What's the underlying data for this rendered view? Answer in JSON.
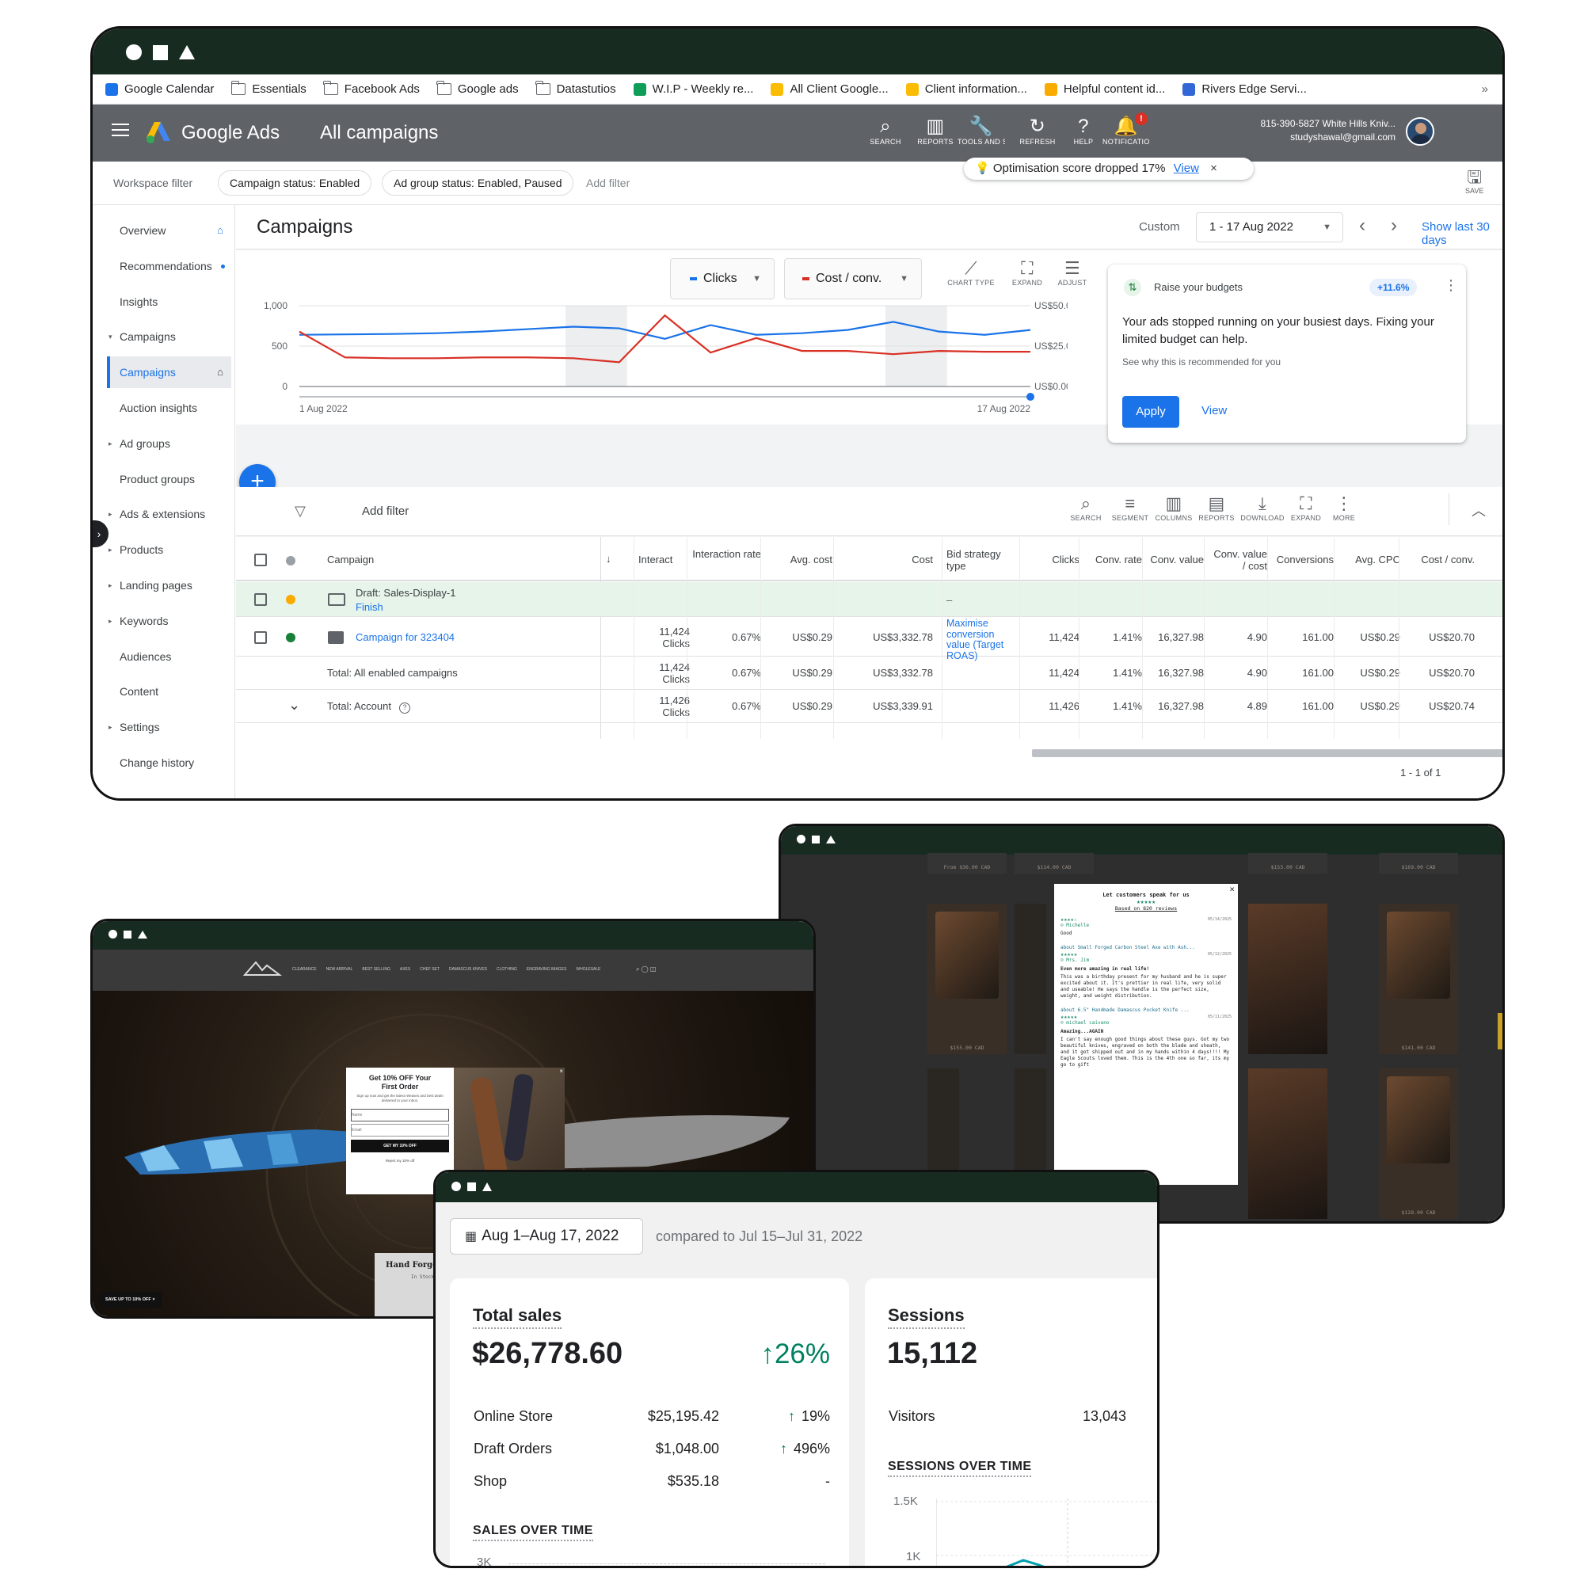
{
  "bookmarks": [
    {
      "label": "Google Calendar",
      "icon": "calendar-icon"
    },
    {
      "label": "Essentials",
      "icon": "folder-icon"
    },
    {
      "label": "Facebook Ads",
      "icon": "folder-icon"
    },
    {
      "label": "Google ads",
      "icon": "folder-icon"
    },
    {
      "label": "Datastutios",
      "icon": "folder-icon"
    },
    {
      "label": "W.I.P - Weekly re...",
      "icon": "sheets-icon"
    },
    {
      "label": "All Client Google...",
      "icon": "drive-icon"
    },
    {
      "label": "Client information...",
      "icon": "drive-icon"
    },
    {
      "label": "Helpful content id...",
      "icon": "keep-icon"
    },
    {
      "label": "Rivers Edge Servi...",
      "icon": "site-icon"
    }
  ],
  "bookmarks_more": "»",
  "header": {
    "brand": "Google Ads",
    "title": "All campaigns",
    "tools": [
      {
        "label": "SEARCH",
        "glyph": "⌕",
        "icon": "search-icon"
      },
      {
        "label": "REPORTS",
        "glyph": "▥",
        "icon": "reports-icon"
      },
      {
        "label": "TOOLS AND SETTINGS",
        "glyph": "🔧",
        "icon": "tools-icon"
      },
      {
        "label": "REFRESH",
        "glyph": "↻",
        "icon": "refresh-icon"
      },
      {
        "label": "HELP",
        "glyph": "?",
        "icon": "help-icon"
      },
      {
        "label": "NOTIFICATIONS",
        "glyph": "🔔",
        "icon": "bell-icon"
      }
    ],
    "notification_badge": "!",
    "account_line1": "815-390-5827 White Hills Kniv...",
    "account_line2": "studyshawal@gmail.com"
  },
  "optimisation_toast": {
    "text": "Optimisation score dropped 17%",
    "link": "View",
    "close": "×"
  },
  "filters": {
    "label": "Workspace filter",
    "chips": [
      "Campaign status: Enabled",
      "Ad group status: Enabled, Paused"
    ],
    "add": "Add filter",
    "save": "SAVE"
  },
  "sidebar": {
    "items": [
      {
        "label": "Overview",
        "caret": ""
      },
      {
        "label": "Recommendations",
        "caret": ""
      },
      {
        "label": "Insights",
        "caret": ""
      },
      {
        "label": "Campaigns",
        "caret": "▾"
      },
      {
        "label": "Campaigns",
        "caret": ""
      },
      {
        "label": "Auction insights",
        "caret": ""
      },
      {
        "label": "Ad groups",
        "caret": "▸"
      },
      {
        "label": "Product groups",
        "caret": ""
      },
      {
        "label": "Ads & extensions",
        "caret": "▸"
      },
      {
        "label": "Products",
        "caret": "▸"
      },
      {
        "label": "Landing pages",
        "caret": "▸"
      },
      {
        "label": "Keywords",
        "caret": "▸"
      },
      {
        "label": "Audiences",
        "caret": ""
      },
      {
        "label": "Content",
        "caret": ""
      },
      {
        "label": "Settings",
        "caret": "▸"
      },
      {
        "label": "Change history",
        "caret": ""
      }
    ]
  },
  "campaigns": {
    "title": "Campaigns",
    "custom_label": "Custom",
    "date_range": "1 - 17 Aug 2022",
    "show_last": "Show last 30 days"
  },
  "chart_controls": {
    "metric1": "Clicks",
    "metric2": "Cost / conv.",
    "tools": [
      {
        "label": "CHART TYPE",
        "glyph": "⟋",
        "icon": "chart-type-icon"
      },
      {
        "label": "EXPAND",
        "glyph": "⛶",
        "icon": "expand-icon"
      },
      {
        "label": "ADJUST",
        "glyph": "☰",
        "icon": "adjust-icon"
      }
    ]
  },
  "chart_data": {
    "type": "line",
    "x": [
      "1 Aug 2022",
      "2",
      "3",
      "4",
      "5",
      "6",
      "7",
      "8",
      "9",
      "10",
      "11",
      "12",
      "13",
      "14",
      "15",
      "16",
      "17 Aug 2022"
    ],
    "x_tick_labels": [
      "1 Aug 2022",
      "17 Aug 2022"
    ],
    "series": [
      {
        "name": "Clicks",
        "axis": "left",
        "color": "#1a73e8",
        "values": [
          640,
          645,
          650,
          660,
          680,
          710,
          740,
          720,
          590,
          760,
          640,
          660,
          700,
          800,
          680,
          640,
          700
        ]
      },
      {
        "name": "Cost / conv.",
        "axis": "right",
        "color": "#d93025",
        "values": [
          34,
          18,
          17.5,
          17.5,
          18,
          18,
          17.5,
          15,
          44,
          21,
          30,
          22,
          22,
          20,
          22,
          21.5,
          21.5
        ]
      }
    ],
    "ylim_left": [
      0,
      1000
    ],
    "yticks_left": [
      "1,000",
      "500",
      "0"
    ],
    "ylim_right": [
      0,
      50
    ],
    "yticks_right": [
      "US$50.00",
      "US$25.00",
      "US$0.00"
    ],
    "weekend_shading": [
      [
        6,
        7
      ],
      [
        13,
        14
      ]
    ],
    "grid": true
  },
  "recommendation": {
    "title": "Raise your budgets",
    "badge": "+11.6%",
    "body": "Your ads stopped running on your busiest days. Fixing your limited budget can help.",
    "sub": "See why this is recommended for you",
    "apply": "Apply",
    "view": "View"
  },
  "table_toolbar": {
    "add_filter": "Add filter",
    "tools": [
      {
        "label": "SEARCH",
        "glyph": "⌕",
        "icon": "search-icon"
      },
      {
        "label": "SEGMENT",
        "glyph": "≡",
        "icon": "segment-icon"
      },
      {
        "label": "COLUMNS",
        "glyph": "▥",
        "icon": "columns-icon"
      },
      {
        "label": "REPORTS",
        "glyph": "▤",
        "icon": "reports-icon"
      },
      {
        "label": "DOWNLOAD",
        "glyph": "⤓",
        "icon": "download-icon"
      },
      {
        "label": "EXPAND",
        "glyph": "⛶",
        "icon": "expand-icon"
      },
      {
        "label": "MORE",
        "glyph": "⋮",
        "icon": "more-icon"
      }
    ]
  },
  "table": {
    "headers": [
      "Campaign",
      "Interact",
      "Interaction rate",
      "Avg. cost",
      "Cost",
      "Bid strategy type",
      "Clicks",
      "Conv. rate",
      "Conv. value",
      "Conv. value / cost",
      "Conversions",
      "Avg. CPC",
      "Cost / conv."
    ],
    "draft": {
      "name": "Draft: Sales-Display-1",
      "action": "Finish",
      "bid": "–"
    },
    "rows": [
      {
        "name": "Campaign for 323404",
        "interact": "11,424",
        "interact_unit": "Clicks",
        "rate": "0.67%",
        "avg_cost": "US$0.29",
        "cost": "US$3,332.78",
        "bid": "Maximise conversion value (Target ROAS)",
        "clicks": "11,424",
        "conv_rate": "1.41%",
        "conv_value": "16,327.98",
        "cv_cost": "4.90",
        "conversions": "161.00",
        "avg_cpc": "US$0.29",
        "cost_conv": "US$20.70"
      },
      {
        "name": "Total: All enabled campaigns",
        "interact": "11,424",
        "interact_unit": "Clicks",
        "rate": "0.67%",
        "avg_cost": "US$0.29",
        "cost": "US$3,332.78",
        "bid": "",
        "clicks": "11,424",
        "conv_rate": "1.41%",
        "conv_value": "16,327.98",
        "cv_cost": "4.90",
        "conversions": "161.00",
        "avg_cpc": "US$0.29",
        "cost_conv": "US$20.70"
      },
      {
        "name": "Total: Account",
        "interact": "11,426",
        "interact_unit": "Clicks",
        "rate": "0.67%",
        "avg_cost": "US$0.29",
        "cost": "US$3,339.91",
        "bid": "",
        "clicks": "11,426",
        "conv_rate": "1.41%",
        "conv_value": "16,327.98",
        "cv_cost": "4.89",
        "conversions": "161.00",
        "avg_cpc": "US$0.29",
        "cost_conv": "US$20.74"
      }
    ],
    "pagination": "1 - 1 of 1"
  },
  "store": {
    "nav": [
      "CLEARANCE",
      "NEW ARRIVAL",
      "BEST SELLING",
      "AXES",
      "CHEF SET",
      "DAMASCUS KNIVES",
      "CLOTHING",
      "ENGRAVING IMAGES",
      "WHOLESALE"
    ],
    "popup_title": "Get 10% OFF Your First Order",
    "popup_sub": "Sign up now and get the latest releases and best deals delivered to your inbox.",
    "name_placeholder": "Name",
    "email_placeholder": "Email",
    "cta": "GET MY 10% OFF",
    "reject": "Reject my 10% off",
    "hero_caption": "Hand Forge",
    "hero_stock": "In Stock",
    "bottom_badge": "SAVE UP TO 10% OFF"
  },
  "reviews": {
    "title": "Let customers speak for us",
    "stars": "★★★★★",
    "based_on": "Based on 820 reviews",
    "items": [
      {
        "stars": "★★★★☆",
        "name": "Michelle",
        "date": "05/14/2025",
        "text": "Good"
      },
      {
        "about": "about Small Forged Carbon Steel Axe with Ash...",
        "stars": "★★★★★",
        "name": "Mrs. Jim",
        "date": "05/12/2025",
        "headline": "Even more amazing in real life!",
        "text": "This was a birthday present for my husband and he is super excited about it. It's prettier in real life, very solid and useable! He says the handle is the perfect size, weight, and weight distribution."
      },
      {
        "about": "about 6.5\" Handmade Damascus Pocket Knife ...",
        "stars": "★★★★★",
        "name": "michael caivano",
        "date": "05/11/2025",
        "headline": "Amazing...AGAIN",
        "text": "I can't say enough good things about these guys. Got my two beautiful knives, engraved on both the blade and sheath, and it got shipped out and in my hands within 4 days!!!! My Eagle Scouts loved them. This is the 4th one so far, its my go to gift"
      }
    ],
    "prices": [
      "From $36.00 CAD",
      "$114.00 CAD",
      "$153.00 CAD",
      "$169.00 CAD",
      "$155.00 CAD",
      "$141.00 CAD",
      "$128.00 CAD"
    ]
  },
  "shopify": {
    "date_range": "Aug 1–Aug 17, 2022",
    "compared": "compared to Jul 15–Jul 31, 2022",
    "total_sales": {
      "title": "Total sales",
      "value": "$26,778.60",
      "change": "26%",
      "rows": [
        {
          "label": "Online Store",
          "value": "$25,195.42",
          "change": "19%"
        },
        {
          "label": "Draft Orders",
          "value": "$1,048.00",
          "change": "496%"
        },
        {
          "label": "Shop",
          "value": "$535.18",
          "change": "-"
        }
      ],
      "chart_title": "SALES OVER TIME",
      "y_tick": "3K"
    },
    "sessions": {
      "title": "Sessions",
      "value": "15,112",
      "visitors_label": "Visitors",
      "visitors_value": "13,043",
      "chart_title": "SESSIONS OVER TIME",
      "y_ticks": [
        "1.5K",
        "1K"
      ]
    },
    "up_arrow": "↑",
    "colors": {
      "positive": "#008060",
      "series": "#00a0ac"
    }
  }
}
